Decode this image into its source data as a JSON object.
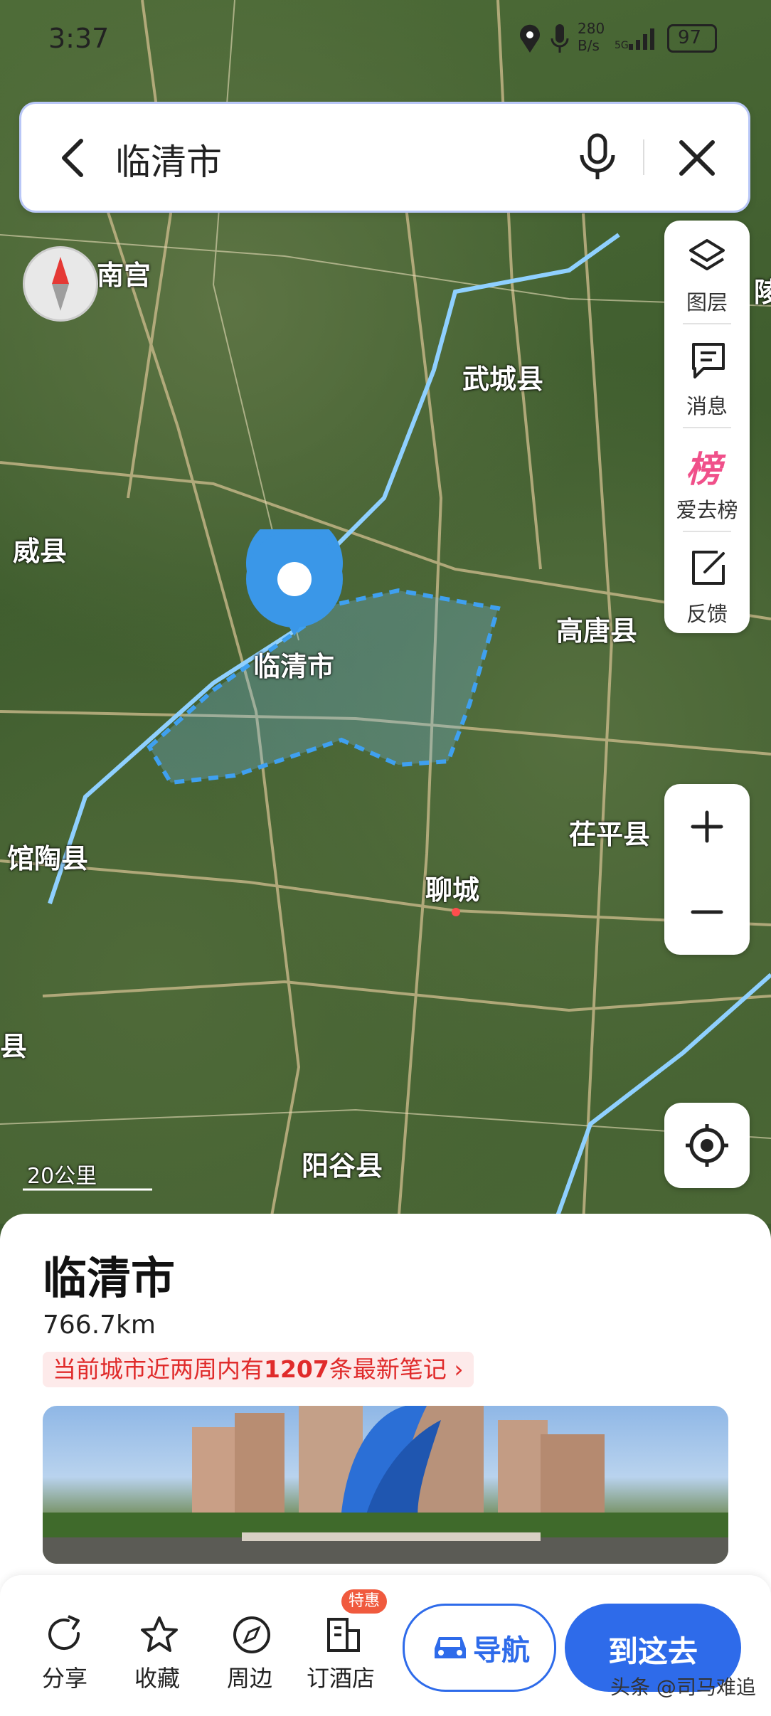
{
  "status_bar": {
    "time": "3:37",
    "net_speed": "280",
    "net_unit": "B/s",
    "battery": "97"
  },
  "search": {
    "query": "临清市"
  },
  "map": {
    "places": [
      "南宫",
      "武城县",
      "威县",
      "高唐县",
      "临清市",
      "茌平县",
      "馆陶县",
      "聊城",
      "阳谷县",
      "县"
    ],
    "scale": "20公里",
    "edge_label": "陵"
  },
  "side_tools": {
    "layers": "图层",
    "messages": "消息",
    "rank_icon": "榜",
    "rank": "爱去榜",
    "feedback": "反馈"
  },
  "sheet": {
    "title": "临清市",
    "distance": "766.7km",
    "notes_prefix": "当前城市近两周内有",
    "notes_count": "1207",
    "notes_suffix": "条最新笔记"
  },
  "actions": {
    "share": "分享",
    "favorite": "收藏",
    "nearby": "周边",
    "hotel": "订酒店",
    "hotel_badge": "特惠",
    "navigate": "导航",
    "go_here": "到这去"
  },
  "watermark": "头条 @司马难追",
  "colors": {
    "accent": "#2e6bea",
    "highlight": "#e02b2b",
    "river": "#8fd0ff",
    "region_border": "#3fa0f0"
  }
}
